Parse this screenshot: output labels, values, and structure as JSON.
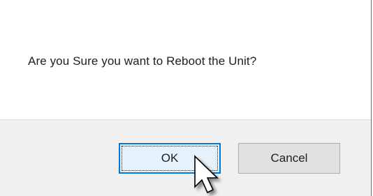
{
  "dialog": {
    "message": "Are you Sure you want to Reboot the Unit?",
    "ok_label": "OK",
    "cancel_label": "Cancel"
  },
  "cursor": {
    "icon": "arrow-pointer-icon"
  },
  "colors": {
    "ok_border": "#0078d7",
    "ok_fill": "#e5f1fb",
    "button_fill": "#e1e1e1",
    "footer_fill": "#f0f0f0"
  }
}
